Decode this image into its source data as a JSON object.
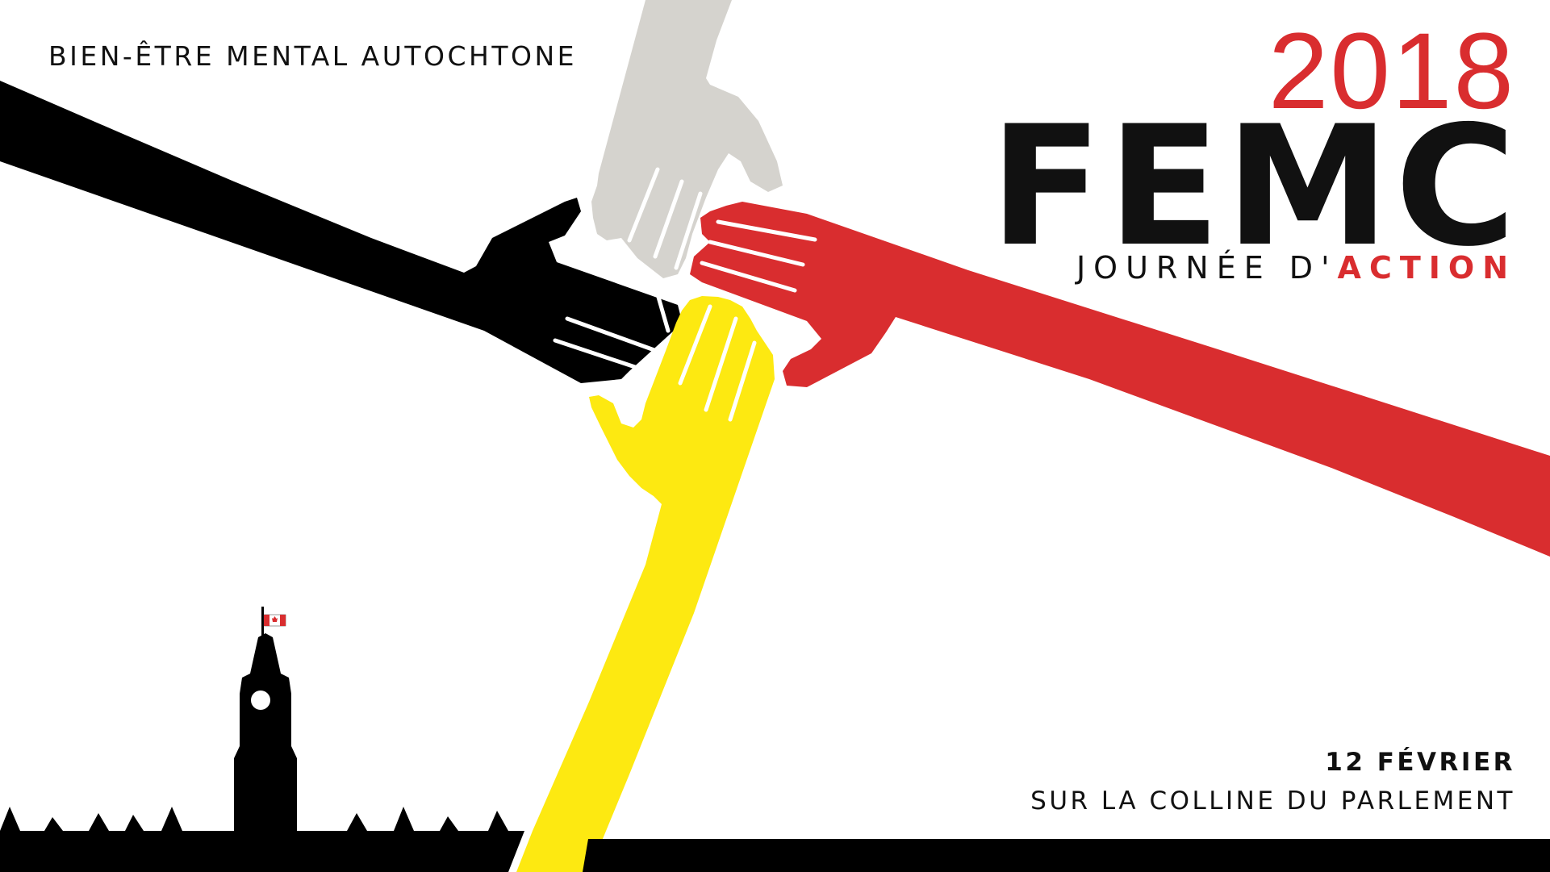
{
  "texts": {
    "tagline": "BIEN-ÊTRE MENTAL AUTOCHTONE",
    "year": "2018",
    "brand": "FEMC",
    "subtitle_prefix": "JOURNÉE D'",
    "subtitle_accent": "ACTION",
    "date": "12 FÉVRIER",
    "place": "SUR LA COLLINE DU PARLEMENT"
  },
  "colors": {
    "red": "#d92d2f",
    "yellow": "#fde911",
    "gray": "#d5d3ce",
    "black": "#000000",
    "text": "#111111"
  },
  "illustration": {
    "hands": [
      "black-arm-hand",
      "gray-arm-hand",
      "red-arm-hand",
      "yellow-arm-hand"
    ],
    "skyline": "parliament-peace-tower-skyline",
    "flag": "canadian-flag-icon"
  }
}
